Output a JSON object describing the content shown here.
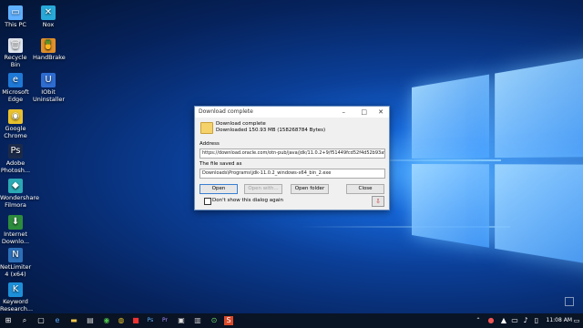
{
  "desktop": {
    "icons": [
      {
        "label": "This PC",
        "icon": "this-pc-icon",
        "color": "#5fb0ff",
        "glyph": "▭"
      },
      {
        "label": "Recycle Bin",
        "icon": "recycle-bin-icon",
        "color": "#e0e6ee",
        "glyph": "🗑"
      },
      {
        "label": "Microsoft Edge",
        "icon": "edge-icon",
        "color": "#1e78d6",
        "glyph": "e"
      },
      {
        "label": "Google Chrome",
        "icon": "chrome-icon",
        "color": "#e8c12d",
        "glyph": "◉"
      },
      {
        "label": "Adobe Photosh...",
        "icon": "photoshop-icon",
        "color": "#1c2a4a",
        "glyph": "Ps"
      },
      {
        "label": "Wondershare Filmora",
        "icon": "filmora-icon",
        "color": "#2ba9b4",
        "glyph": "◆"
      },
      {
        "label": "Internet Downlo...",
        "icon": "idm-icon",
        "color": "#2c8c3c",
        "glyph": "⬇"
      },
      {
        "label": "NetLimiter 4 (x64)",
        "icon": "netlimiter-icon",
        "color": "#2d6fb8",
        "glyph": "N"
      },
      {
        "label": "Keyword Research...",
        "icon": "keyword-research-icon",
        "color": "#1d8fd8",
        "glyph": "K"
      },
      {
        "label": "Nox",
        "icon": "nox-icon",
        "color": "#27a9d9",
        "glyph": "✕"
      },
      {
        "label": "HandBrake",
        "icon": "handbrake-icon",
        "color": "#e0902a",
        "glyph": "🍍"
      },
      {
        "label": "IObit Uninstaller",
        "icon": "iobit-icon",
        "color": "#2e6cd1",
        "glyph": "U"
      }
    ]
  },
  "dialog": {
    "title": "Download complete",
    "heading": "Download complete",
    "size_text": "Downloaded 150.93 MB (158268784 Bytes)",
    "address_label": "Address",
    "address_value": "https://download.oracle.com/otn-pub/java/jdk/11.0.2+9/f51449fcd52f4d52b93a989c5c",
    "saved_label": "The file saved as",
    "saved_value": "Downloads\\Programs\\jdk-11.0.2_windows-x64_bin_2.exe",
    "buttons": {
      "open": "Open",
      "open_with": "Open with...",
      "open_folder": "Open folder",
      "close": "Close"
    },
    "checkbox_label": "Don't show this dialog again",
    "checkbox_checked": false
  },
  "taskbar": {
    "time": "11:08 AM",
    "colors": {
      "accent": "#1e78d6"
    }
  }
}
